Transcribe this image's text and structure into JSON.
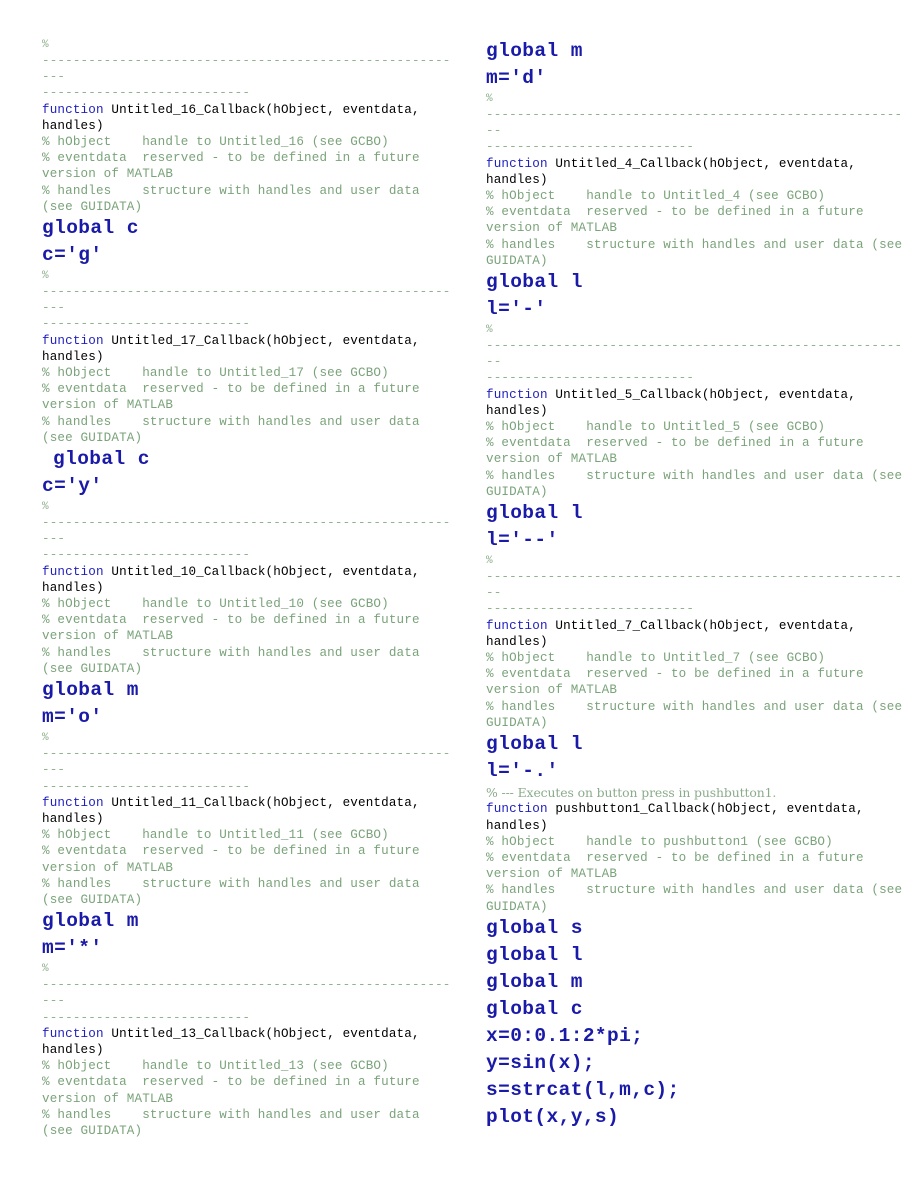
{
  "document": {
    "kind": "matlab-code-listing",
    "title": "MATLAB GUIDE callback source listing",
    "background_color": "#ffffff",
    "colors": {
      "keyword_blue": "#1f1fbf",
      "statement_blue": "#1a1aa8",
      "comment_green": "#7aa37a",
      "separator_green": "#8fb28f",
      "plain_black": "#000000"
    },
    "separator_long": "%--------------------------------------------------------------------------",
    "boilerplate": {
      "pct": "%",
      "eventdata_line": "% eventdata  reserved - to be defined in a future version of MATLAB",
      "handles_line": "% handles    structure with handles and user data (see GUIDATA)",
      "signature_tail": "_Callback(hObject, eventdata, handles)",
      "keyword_function": "function",
      "hobject_prefix": "% hObject    handle to ",
      "hobject_suffix": " (see GCBO)"
    }
  },
  "left_column": [
    {
      "type": "pct",
      "text": "%"
    },
    {
      "type": "separator",
      "line1": "--------------------------------------------------------",
      "line2": "---------------------------"
    },
    {
      "type": "signature",
      "keyword": "function",
      "name": "Untitled_16_Callback(hObject, eventdata, handles)"
    },
    {
      "type": "comment",
      "text": "% hObject    handle to Untitled_16 (see GCBO)"
    },
    {
      "type": "comment",
      "text": "% eventdata  reserved - to be defined in a future version of MATLAB"
    },
    {
      "type": "comment",
      "text": "% handles    structure with handles and user data (see GUIDATA)"
    },
    {
      "type": "bold",
      "text": "global c"
    },
    {
      "type": "bold",
      "text": "c='g'"
    },
    {
      "type": "pct",
      "text": "%"
    },
    {
      "type": "separator",
      "line1": "--------------------------------------------------------",
      "line2": "---------------------------"
    },
    {
      "type": "signature",
      "keyword": "function",
      "name": "Untitled_17_Callback(hObject, eventdata, handles)"
    },
    {
      "type": "comment",
      "text": "% hObject    handle to Untitled_17 (see GCBO)"
    },
    {
      "type": "comment",
      "text": "% eventdata  reserved - to be defined in a future version of MATLAB"
    },
    {
      "type": "comment",
      "text": "% handles    structure with handles and user data (see GUIDATA)"
    },
    {
      "type": "bold",
      "indent": 1,
      "text": "global c"
    },
    {
      "type": "bold",
      "text": "c='y'"
    },
    {
      "type": "pct",
      "text": "%"
    },
    {
      "type": "separator",
      "line1": "--------------------------------------------------------",
      "line2": "---------------------------"
    },
    {
      "type": "signature",
      "keyword": "function",
      "name": "Untitled_10_Callback(hObject, eventdata, handles)"
    },
    {
      "type": "comment",
      "text": "% hObject    handle to Untitled_10 (see GCBO)"
    },
    {
      "type": "comment",
      "text": "% eventdata  reserved - to be defined in a future version of MATLAB"
    },
    {
      "type": "comment",
      "text": "% handles    structure with handles and user data (see GUIDATA)"
    },
    {
      "type": "bold",
      "text": "global m"
    },
    {
      "type": "bold",
      "text": "m='o'"
    },
    {
      "type": "pct",
      "text": "%"
    },
    {
      "type": "separator",
      "line1": "--------------------------------------------------------",
      "line2": "---------------------------"
    },
    {
      "type": "signature",
      "keyword": "function",
      "name": "Untitled_11_Callback(hObject, eventdata, handles)"
    },
    {
      "type": "comment",
      "text": "% hObject    handle to Untitled_11 (see GCBO)"
    },
    {
      "type": "comment",
      "text": "% eventdata  reserved - to be defined in a future version of MATLAB"
    },
    {
      "type": "comment",
      "text": "% handles    structure with handles and user data (see GUIDATA)"
    },
    {
      "type": "bold",
      "text": "global m"
    },
    {
      "type": "bold",
      "text": "m='*'"
    },
    {
      "type": "pct",
      "text": "%"
    },
    {
      "type": "separator",
      "line1": "--------------------------------------------------------",
      "line2": "---------------------------"
    },
    {
      "type": "signature",
      "keyword": "function",
      "name": "Untitled_13_Callback(hObject, eventdata, handles)"
    },
    {
      "type": "comment",
      "text": "% hObject    handle to Untitled_13 (see GCBO)"
    },
    {
      "type": "comment",
      "text": "% eventdata  reserved - to be defined in a future version of MATLAB"
    },
    {
      "type": "comment",
      "text": "% handles    structure with handles and user data (see GUIDATA)"
    }
  ],
  "right_column": [
    {
      "type": "bold",
      "text": "global m"
    },
    {
      "type": "bold",
      "text": "m='d'"
    },
    {
      "type": "pct",
      "text": "%"
    },
    {
      "type": "separator",
      "line1": "--------------------------------------------------------",
      "line2": "---------------------------"
    },
    {
      "type": "signature",
      "keyword": "function",
      "name": "Untitled_4_Callback(hObject, eventdata, handles)"
    },
    {
      "type": "comment",
      "text": "% hObject    handle to Untitled_4 (see GCBO)"
    },
    {
      "type": "comment",
      "text": "% eventdata  reserved - to be defined in a future version of MATLAB"
    },
    {
      "type": "comment",
      "text": "% handles    structure with handles and user data (see GUIDATA)"
    },
    {
      "type": "bold",
      "text": "global l"
    },
    {
      "type": "bold",
      "text": "l='-'"
    },
    {
      "type": "pct",
      "text": "%"
    },
    {
      "type": "separator",
      "line1": "--------------------------------------------------------",
      "line2": "---------------------------"
    },
    {
      "type": "signature",
      "keyword": "function",
      "name": "Untitled_5_Callback(hObject, eventdata, handles)"
    },
    {
      "type": "comment",
      "text": "% hObject    handle to Untitled_5 (see GCBO)"
    },
    {
      "type": "comment",
      "text": "% eventdata  reserved - to be defined in a future version of MATLAB"
    },
    {
      "type": "comment",
      "text": "% handles    structure with handles and user data (see GUIDATA)"
    },
    {
      "type": "bold",
      "text": "global l"
    },
    {
      "type": "bold",
      "text": "l='--'"
    },
    {
      "type": "pct",
      "text": "%"
    },
    {
      "type": "separator",
      "line1": "--------------------------------------------------------",
      "line2": "---------------------------"
    },
    {
      "type": "signature",
      "keyword": "function",
      "name": "Untitled_7_Callback(hObject, eventdata, handles)"
    },
    {
      "type": "comment",
      "text": "% hObject    handle to Untitled_7 (see GCBO)"
    },
    {
      "type": "comment",
      "text": "% eventdata  reserved - to be defined in a future version of MATLAB"
    },
    {
      "type": "comment",
      "text": "% handles    structure with handles and user data (see GUIDATA)"
    },
    {
      "type": "bold",
      "text": "global l"
    },
    {
      "type": "bold",
      "text": "l='-.'"
    },
    {
      "type": "note",
      "text": "% --- Executes on button press in pushbutton1."
    },
    {
      "type": "signature",
      "keyword": "function",
      "name": "pushbutton1_Callback(hObject, eventdata, handles)"
    },
    {
      "type": "comment",
      "text": "% hObject    handle to pushbutton1 (see GCBO)"
    },
    {
      "type": "comment",
      "text": "% eventdata  reserved - to be defined in a future version of MATLAB"
    },
    {
      "type": "comment",
      "text": "% handles    structure with handles and user data (see GUIDATA)"
    },
    {
      "type": "bold",
      "text": "global s"
    },
    {
      "type": "bold",
      "text": "global l"
    },
    {
      "type": "bold",
      "text": "global m"
    },
    {
      "type": "bold",
      "text": "global c"
    },
    {
      "type": "bold",
      "text": "x=0:0.1:2*pi;"
    },
    {
      "type": "bold",
      "text": "y=sin(x);"
    },
    {
      "type": "bold",
      "text": "s=strcat(l,m,c);"
    },
    {
      "type": "bold",
      "text": "plot(x,y,s)"
    }
  ]
}
